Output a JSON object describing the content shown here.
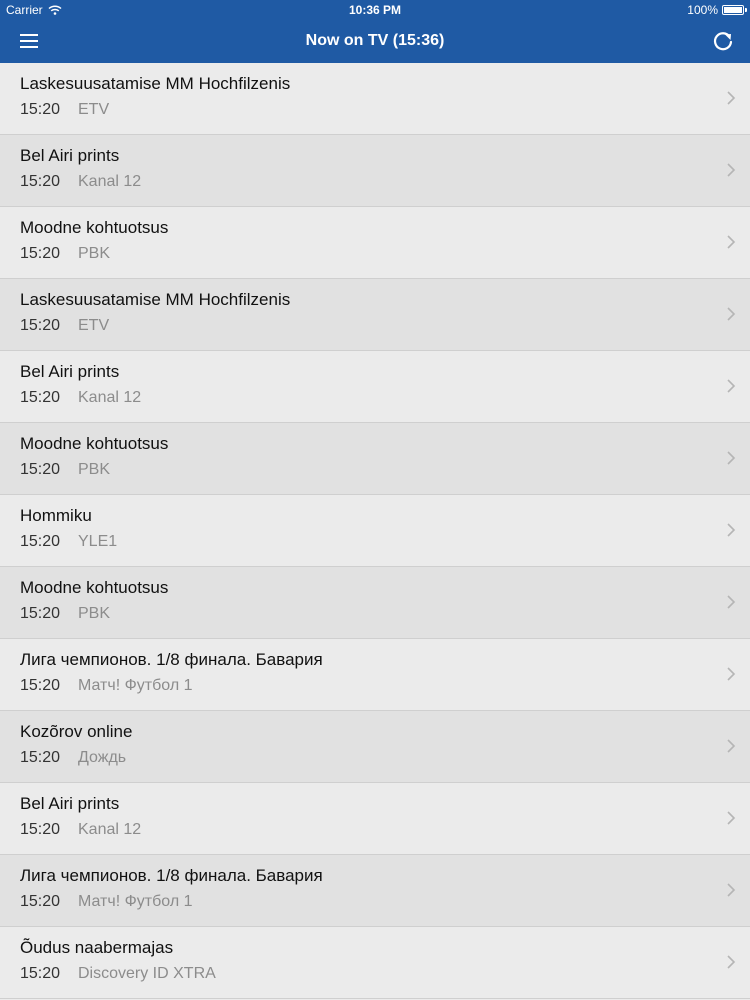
{
  "status_bar": {
    "carrier": "Carrier",
    "wifi_icon": "wifi-icon",
    "time": "10:36 PM",
    "battery": "100%",
    "battery_level": 1.0
  },
  "nav": {
    "title": "Now on TV (15:36)",
    "menu_icon": "hamburger-menu-icon",
    "refresh_icon": "refresh-icon"
  },
  "colors": {
    "nav_background": "#1f5aa4",
    "row_light": "#ebebeb",
    "row_dark": "#e1e1e1",
    "channel_text": "#8c8c8c"
  },
  "programs": [
    {
      "title": "Laskesuusatamise MM Hochfilzenis",
      "time": "15:20",
      "channel": "ETV"
    },
    {
      "title": "Bel Airi prints",
      "time": "15:20",
      "channel": "Kanal 12"
    },
    {
      "title": "Moodne kohtuotsus",
      "time": "15:20",
      "channel": "PBK"
    },
    {
      "title": "Laskesuusatamise MM Hochfilzenis",
      "time": "15:20",
      "channel": "ETV"
    },
    {
      "title": "Bel Airi prints",
      "time": "15:20",
      "channel": "Kanal 12"
    },
    {
      "title": "Moodne kohtuotsus",
      "time": "15:20",
      "channel": "PBK"
    },
    {
      "title": "Hommiku",
      "time": "15:20",
      "channel": "YLE1"
    },
    {
      "title": "Moodne kohtuotsus",
      "time": "15:20",
      "channel": "PBK"
    },
    {
      "title": "Лига чемпионов. 1/8 финала. Бавария",
      "time": "15:20",
      "channel": "Матч! Футбол 1"
    },
    {
      "title": "Kozõrov online",
      "time": "15:20",
      "channel": "Дождь"
    },
    {
      "title": "Bel Airi prints",
      "time": "15:20",
      "channel": "Kanal 12"
    },
    {
      "title": "Лига чемпионов. 1/8 финала. Бавария",
      "time": "15:20",
      "channel": "Матч! Футбол 1"
    },
    {
      "title": "Õudus naabermajas",
      "time": "15:20",
      "channel": "Discovery ID XTRA"
    }
  ]
}
